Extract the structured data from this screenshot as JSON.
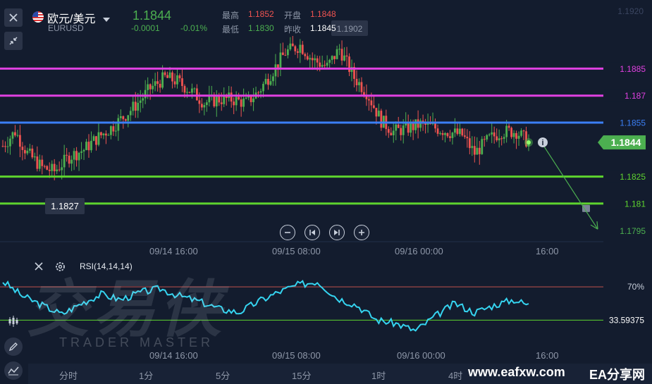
{
  "header": {
    "pair": "欧元/美元",
    "symbol": "EURUSD",
    "price": "1.1844",
    "change": "-0.0001",
    "change_pct": "-0.01%",
    "high_label": "最高",
    "high_value": "1.1852",
    "open_label": "开盘",
    "open_value": "1.1848",
    "low_label": "最低",
    "low_value": "1.1830",
    "prev_label": "昨收",
    "prev_value": "1.1845"
  },
  "price_axis": {
    "top_label": "1.1920",
    "current_price": "1.1844",
    "levels": [
      {
        "value": 1.1885,
        "label": "1.1885",
        "color": "#e040e0"
      },
      {
        "value": 1.187,
        "label": "1.187",
        "color": "#e040e0"
      },
      {
        "value": 1.1855,
        "label": "1.1855",
        "color": "#3b7ff5"
      },
      {
        "value": 1.1825,
        "label": "1.1825",
        "color": "#5ed42e"
      },
      {
        "value": 1.181,
        "label": "1.181",
        "color": "#5ed42e"
      }
    ],
    "target_label": "1.1795"
  },
  "annotations": {
    "high_marker": "1.1902",
    "low_marker": "1.1827"
  },
  "time_axis": [
    "09/14 16:00",
    "09/15 08:00",
    "09/16 00:00",
    "16:00"
  ],
  "indicator": {
    "name": "RSI(14,14,14)",
    "upper_label": "70%",
    "lower_label": "33.59375"
  },
  "timeframes": [
    "分时",
    "1分",
    "5分",
    "15分",
    "1时",
    "4时"
  ],
  "watermark": {
    "title": "交易侠",
    "subtitle": "TRADER MASTER",
    "site": "www.eafxw.com",
    "brand": "EA分享网"
  },
  "colors": {
    "up": "#4caf50",
    "down": "#ef5350",
    "background": "#131c2e",
    "rsi_line": "#35d4f0"
  },
  "chart_data": {
    "type": "candlestick",
    "y_range": [
      1.179,
      1.192
    ],
    "current_price": 1.1844,
    "horizontal_levels": [
      1.1885,
      1.187,
      1.1855,
      1.1825,
      1.181
    ],
    "target_price": 1.1795,
    "close_path": [
      [
        0,
        1.1842
      ],
      [
        5,
        1.185
      ],
      [
        10,
        1.1838
      ],
      [
        16,
        1.183
      ],
      [
        21,
        1.1828
      ],
      [
        27,
        1.1836
      ],
      [
        33,
        1.184
      ],
      [
        38,
        1.1846
      ],
      [
        44,
        1.1852
      ],
      [
        49,
        1.1858
      ],
      [
        55,
        1.1866
      ],
      [
        60,
        1.1874
      ],
      [
        66,
        1.188
      ],
      [
        71,
        1.1878
      ],
      [
        77,
        1.1872
      ],
      [
        82,
        1.1866
      ],
      [
        88,
        1.1868
      ],
      [
        93,
        1.1868
      ],
      [
        99,
        1.1866
      ],
      [
        104,
        1.1872
      ],
      [
        110,
        1.1884
      ],
      [
        115,
        1.1894
      ],
      [
        121,
        1.1898
      ],
      [
        126,
        1.189
      ],
      [
        132,
        1.1886
      ],
      [
        137,
        1.1896
      ],
      [
        143,
        1.188
      ],
      [
        148,
        1.1872
      ],
      [
        154,
        1.1856
      ],
      [
        159,
        1.185
      ],
      [
        165,
        1.1852
      ],
      [
        170,
        1.1854
      ],
      [
        176,
        1.1852
      ],
      [
        181,
        1.185
      ],
      [
        187,
        1.1848
      ],
      [
        192,
        1.1838
      ],
      [
        198,
        1.1846
      ],
      [
        203,
        1.185
      ],
      [
        209,
        1.185
      ],
      [
        214,
        1.1844
      ]
    ],
    "rsi_range": [
      0,
      100
    ],
    "rsi_levels": [
      70,
      33.59375
    ],
    "rsi_path": [
      [
        0,
        76
      ],
      [
        8,
        60
      ],
      [
        16,
        50
      ],
      [
        24,
        40
      ],
      [
        32,
        52
      ],
      [
        40,
        62
      ],
      [
        48,
        56
      ],
      [
        56,
        64
      ],
      [
        64,
        68
      ],
      [
        72,
        60
      ],
      [
        80,
        54
      ],
      [
        88,
        46
      ],
      [
        96,
        42
      ],
      [
        104,
        54
      ],
      [
        112,
        64
      ],
      [
        120,
        72
      ],
      [
        128,
        76
      ],
      [
        136,
        58
      ],
      [
        144,
        50
      ],
      [
        152,
        34
      ],
      [
        160,
        30
      ],
      [
        168,
        22
      ],
      [
        176,
        38
      ],
      [
        184,
        52
      ],
      [
        192,
        42
      ],
      [
        200,
        50
      ],
      [
        208,
        56
      ],
      [
        214,
        50
      ]
    ]
  }
}
